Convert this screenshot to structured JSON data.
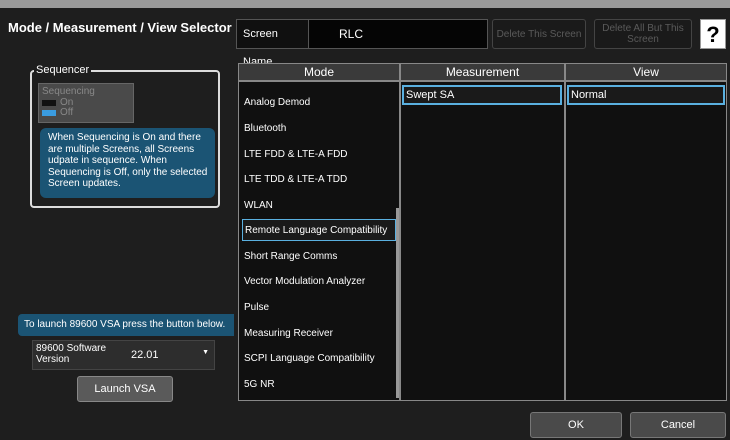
{
  "header": {
    "title": "Mode / Measurement / View Selector",
    "screen_name_label": "Screen Name",
    "screen_name_value": "RLC",
    "delete_this_screen": "Delete This Screen",
    "delete_all_but": "Delete All But This Screen",
    "help_label": "?"
  },
  "sequencer": {
    "legend": "Sequencer",
    "toggle_label": "Sequencing",
    "on_label": "On",
    "off_label": "Off",
    "note": "When Sequencing is On and there are multiple Screens, all Screens udpate in sequence. When Sequencing is Off, only the selected Screen updates."
  },
  "launch": {
    "note": "To launch 89600 VSA press the button below.",
    "version_label": "89600 Software Version",
    "version_value": "22.01",
    "button": "Launch VSA"
  },
  "columns": {
    "mode_header": "Mode",
    "measurement_header": "Measurement",
    "view_header": "View",
    "modes": [
      "Analog Demod",
      "Bluetooth",
      "LTE FDD & LTE-A FDD",
      "LTE TDD & LTE-A TDD",
      "WLAN",
      "Remote Language Compatibility",
      "Short Range Comms",
      "Vector Modulation Analyzer",
      "Pulse",
      "Measuring Receiver",
      "SCPI Language Compatibility",
      "5G NR"
    ],
    "selected_mode": "Remote Language Compatibility",
    "measurements": [
      "Swept SA"
    ],
    "views": [
      "Normal"
    ]
  },
  "footer": {
    "ok": "OK",
    "cancel": "Cancel"
  }
}
